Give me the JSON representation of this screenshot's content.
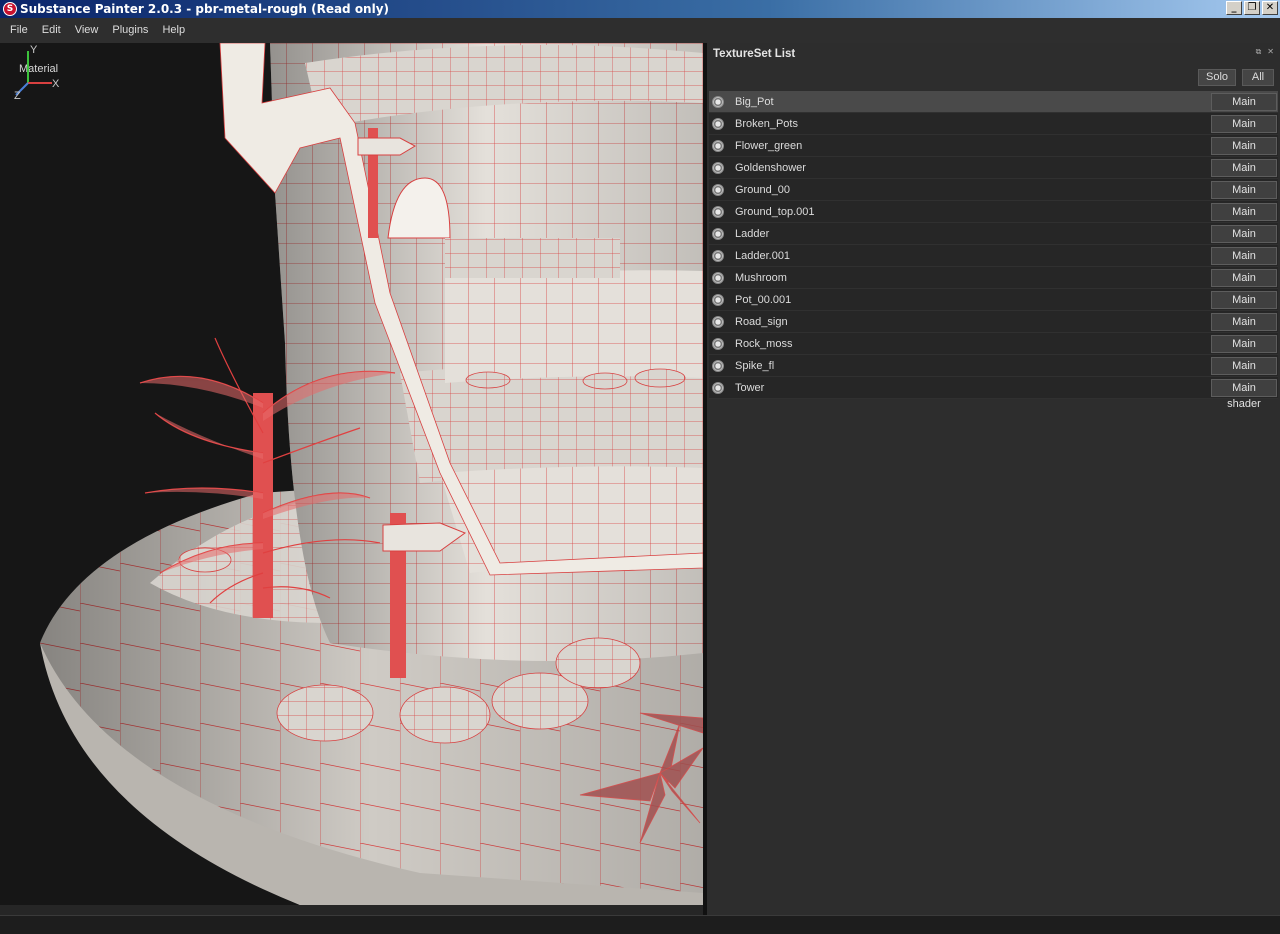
{
  "window": {
    "title": "Substance Painter 2.0.3 - pbr-metal-rough (Read only)",
    "icon": "substance-logo-icon",
    "controls": [
      "minimize",
      "restore",
      "close"
    ]
  },
  "menu": {
    "items": [
      "File",
      "Edit",
      "View",
      "Plugins",
      "Help"
    ]
  },
  "viewport": {
    "label": "Material",
    "gizmo": {
      "x": "X",
      "y": "Y",
      "z": "Z"
    },
    "wireframe_color": "#e03030",
    "surface_color": "#e6e2dc"
  },
  "panel": {
    "title": "TextureSet List",
    "buttons": {
      "solo": "Solo",
      "all": "All"
    },
    "texture_sets": [
      {
        "name": "Big_Pot",
        "shader": "Main shader",
        "selected": true
      },
      {
        "name": "Broken_Pots",
        "shader": "Main shader"
      },
      {
        "name": "Flower_green",
        "shader": "Main shader"
      },
      {
        "name": "Goldenshower",
        "shader": "Main shader"
      },
      {
        "name": "Ground_00",
        "shader": "Main shader"
      },
      {
        "name": "Ground_top.001",
        "shader": "Main shader"
      },
      {
        "name": "Ladder",
        "shader": "Main shader"
      },
      {
        "name": "Ladder.001",
        "shader": "Main shader"
      },
      {
        "name": "Mushroom",
        "shader": "Main shader"
      },
      {
        "name": "Pot_00.001",
        "shader": "Main shader"
      },
      {
        "name": "Road_sign",
        "shader": "Main shader"
      },
      {
        "name": "Rock_moss",
        "shader": "Main shader"
      },
      {
        "name": "Spike_fl",
        "shader": "Main shader"
      },
      {
        "name": "Tower",
        "shader": "Main shader"
      }
    ]
  }
}
